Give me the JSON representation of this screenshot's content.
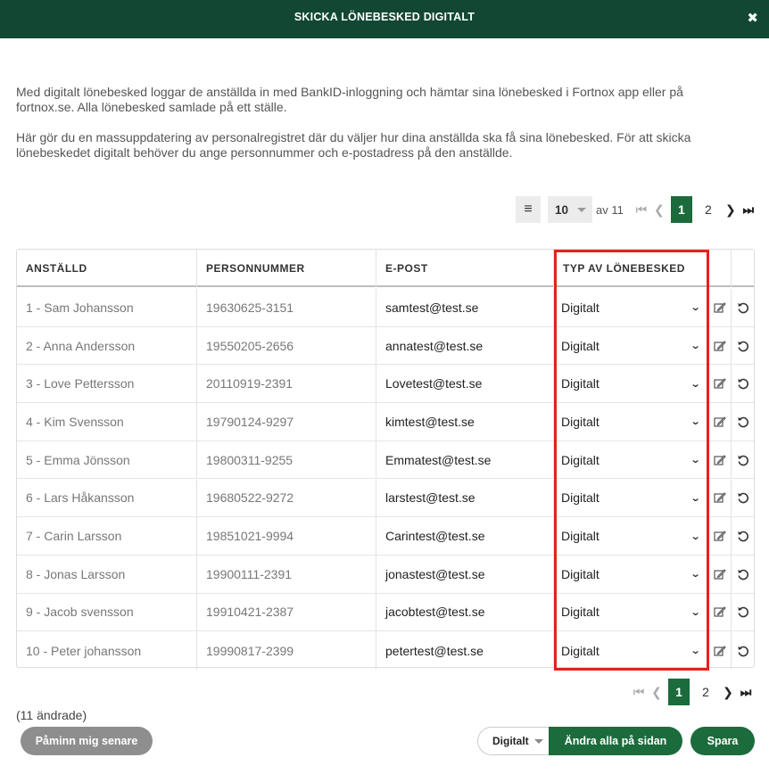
{
  "dialog": {
    "title": "SKICKA LÖNEBESKED DIGITALT",
    "close_glyph": "✖"
  },
  "intro": {
    "p1": "Med digitalt lönebesked loggar de anställda in med BankID-inloggning och hämtar sina lönebesked i Fortnox app eller på fortnox.se. Alla lönebesked samlade på ett ställe.",
    "p2": "Här gör du en massuppdatering av personalregistret där du väljer hur dina anställda ska få sina lönebesked. För att skicka lönebeskedet digitalt behöver du ange personnummer och e-postadress på den anställde."
  },
  "pagination": {
    "page_size": "10",
    "of_label": "av 11",
    "pages": [
      "1",
      "2"
    ],
    "current_page": "1"
  },
  "table": {
    "headers": [
      "ANSTÄLLD",
      "PERSONNUMMER",
      "E-POST",
      "TYP AV LÖNEBESKED"
    ],
    "rows": [
      {
        "employee": "1 - Sam Johansson",
        "personnummer": "19630625-3151",
        "email": "samtest@test.se",
        "type": "Digitalt"
      },
      {
        "employee": "2 - Anna Andersson",
        "personnummer": "19550205-2656",
        "email": "annatest@test.se",
        "type": "Digitalt"
      },
      {
        "employee": "3 - Love Pettersson",
        "personnummer": "20110919-2391",
        "email": "Lovetest@test.se",
        "type": "Digitalt"
      },
      {
        "employee": "4 - Kim  Svensson",
        "personnummer": "19790124-9297",
        "email": "kimtest@test.se",
        "type": "Digitalt"
      },
      {
        "employee": "5 - Emma  Jönsson",
        "personnummer": "19800311-9255",
        "email": "Emmatest@test.se",
        "type": "Digitalt"
      },
      {
        "employee": "6 - Lars  Håkansson",
        "personnummer": "19680522-9272",
        "email": "larstest@test.se",
        "type": "Digitalt"
      },
      {
        "employee": "7 - Carin Larsson",
        "personnummer": "19851021-9994",
        "email": "Carintest@test.se",
        "type": "Digitalt"
      },
      {
        "employee": "8 - Jonas Larsson",
        "personnummer": "19900111-2391",
        "email": "jonastest@test.se",
        "type": "Digitalt"
      },
      {
        "employee": "9 - Jacob svensson",
        "personnummer": "19910421-2387",
        "email": "jacobtest@test.se",
        "type": "Digitalt"
      },
      {
        "employee": "10 - Peter  johansson",
        "personnummer": "19990817-2399",
        "email": "petertest@test.se",
        "type": "Digitalt"
      }
    ]
  },
  "footer": {
    "changed_count": "(11 ändrade)",
    "remind_label": "Påminn mig senare",
    "bulk_type": "Digitalt",
    "apply_all_label": "Ändra alla på sidan",
    "save_label": "Spara"
  },
  "colors": {
    "header_bg": "#124734",
    "primary_green": "#1c6b3c",
    "highlight_red": "#e2231a",
    "gray_button": "#8e8e8e"
  },
  "icons": {
    "close": "close-icon",
    "menu": "list-menu-icon",
    "edit": "edit-icon",
    "undo": "undo-icon",
    "first": "first-page-icon",
    "prev": "prev-page-icon",
    "next": "next-page-icon",
    "last": "last-page-icon"
  }
}
